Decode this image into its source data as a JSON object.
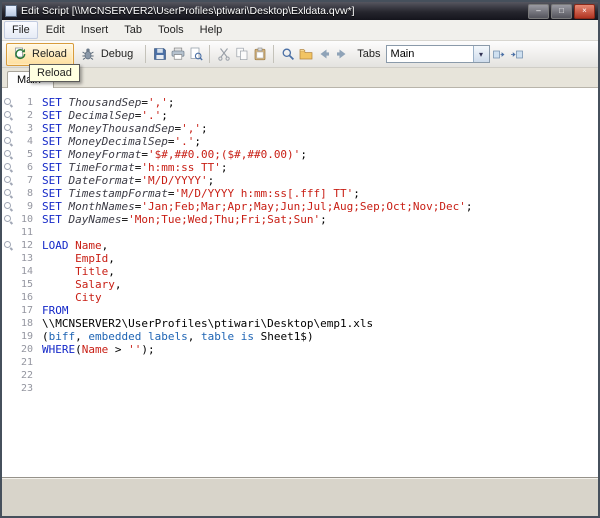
{
  "window": {
    "title": "Edit Script [\\\\MCNSERVER2\\UserProfiles\\ptiwari\\Desktop\\Exldata.qvw*]",
    "buttons": {
      "minimize": "–",
      "maximize": "□",
      "close": "×"
    }
  },
  "menu": {
    "items": [
      "File",
      "Edit",
      "Insert",
      "Tab",
      "Tools",
      "Help"
    ]
  },
  "toolbar": {
    "reload_label": "Reload",
    "debug_label": "Debug",
    "tabs_label": "Tabs",
    "tab_select_value": "Main",
    "dropdown_arrow": "▾",
    "accent_hot_border": "#d89c3c",
    "accent_hot_fill": "#ffdf9c"
  },
  "tabs": {
    "active": "Main"
  },
  "tooltip": {
    "text": "Reload"
  },
  "editor": {
    "syntax_colors": {
      "keyword": "#1428c8",
      "variable": "#3c3c46",
      "string": "#c81e14",
      "field": "#c81e14",
      "format_spec": "#1e64b4",
      "plain": "#000000"
    },
    "lines": [
      {
        "n": "1",
        "m": true,
        "s": [
          [
            "SET ",
            "kw"
          ],
          [
            "ThousandSep",
            "var"
          ],
          [
            "=",
            "pl"
          ],
          [
            "','",
            "str"
          ],
          [
            ";",
            "pl"
          ]
        ]
      },
      {
        "n": "2",
        "m": true,
        "s": [
          [
            "SET ",
            "kw"
          ],
          [
            "DecimalSep",
            "var"
          ],
          [
            "=",
            "pl"
          ],
          [
            "'.'",
            "str"
          ],
          [
            ";",
            "pl"
          ]
        ]
      },
      {
        "n": "3",
        "m": true,
        "s": [
          [
            "SET ",
            "kw"
          ],
          [
            "MoneyThousandSep",
            "var"
          ],
          [
            "=",
            "pl"
          ],
          [
            "','",
            "str"
          ],
          [
            ";",
            "pl"
          ]
        ]
      },
      {
        "n": "4",
        "m": true,
        "s": [
          [
            "SET ",
            "kw"
          ],
          [
            "MoneyDecimalSep",
            "var"
          ],
          [
            "=",
            "pl"
          ],
          [
            "'.'",
            "str"
          ],
          [
            ";",
            "pl"
          ]
        ]
      },
      {
        "n": "5",
        "m": true,
        "s": [
          [
            "SET ",
            "kw"
          ],
          [
            "MoneyFormat",
            "var"
          ],
          [
            "=",
            "pl"
          ],
          [
            "'$#,##0.00;($#,##0.00)'",
            "str"
          ],
          [
            ";",
            "pl"
          ]
        ]
      },
      {
        "n": "6",
        "m": true,
        "s": [
          [
            "SET ",
            "kw"
          ],
          [
            "TimeFormat",
            "var"
          ],
          [
            "=",
            "pl"
          ],
          [
            "'h:mm:ss TT'",
            "str"
          ],
          [
            ";",
            "pl"
          ]
        ]
      },
      {
        "n": "7",
        "m": true,
        "s": [
          [
            "SET ",
            "kw"
          ],
          [
            "DateFormat",
            "var"
          ],
          [
            "=",
            "pl"
          ],
          [
            "'M/D/YYYY'",
            "str"
          ],
          [
            ";",
            "pl"
          ]
        ]
      },
      {
        "n": "8",
        "m": true,
        "s": [
          [
            "SET ",
            "kw"
          ],
          [
            "TimestampFormat",
            "var"
          ],
          [
            "=",
            "pl"
          ],
          [
            "'M/D/YYYY h:mm:ss[.fff] TT'",
            "str"
          ],
          [
            ";",
            "pl"
          ]
        ]
      },
      {
        "n": "9",
        "m": true,
        "s": [
          [
            "SET ",
            "kw"
          ],
          [
            "MonthNames",
            "var"
          ],
          [
            "=",
            "pl"
          ],
          [
            "'Jan;Feb;Mar;Apr;May;Jun;Jul;Aug;Sep;Oct;Nov;Dec'",
            "str"
          ],
          [
            ";",
            "pl"
          ]
        ]
      },
      {
        "n": "10",
        "m": true,
        "s": [
          [
            "SET ",
            "kw"
          ],
          [
            "DayNames",
            "var"
          ],
          [
            "=",
            "pl"
          ],
          [
            "'Mon;Tue;Wed;Thu;Fri;Sat;Sun'",
            "str"
          ],
          [
            ";",
            "pl"
          ]
        ]
      },
      {
        "n": "11",
        "m": false,
        "s": []
      },
      {
        "n": "12",
        "m": true,
        "s": [
          [
            "LOAD ",
            "kw"
          ],
          [
            "Name",
            "fld"
          ],
          [
            ",",
            "pl"
          ]
        ]
      },
      {
        "n": "13",
        "m": false,
        "s": [
          [
            "     ",
            "pl"
          ],
          [
            "EmpId",
            "fld"
          ],
          [
            ",",
            "pl"
          ]
        ]
      },
      {
        "n": "14",
        "m": false,
        "s": [
          [
            "     ",
            "pl"
          ],
          [
            "Title",
            "fld"
          ],
          [
            ",",
            "pl"
          ]
        ]
      },
      {
        "n": "15",
        "m": false,
        "s": [
          [
            "     ",
            "pl"
          ],
          [
            "Salary",
            "fld"
          ],
          [
            ",",
            "pl"
          ]
        ]
      },
      {
        "n": "16",
        "m": false,
        "s": [
          [
            "     ",
            "pl"
          ],
          [
            "City",
            "fld"
          ]
        ]
      },
      {
        "n": "17",
        "m": false,
        "s": [
          [
            "FROM",
            "kw"
          ]
        ]
      },
      {
        "n": "18",
        "m": false,
        "s": [
          [
            "\\\\MCNSERVER2\\UserProfiles\\ptiwari\\Desktop\\emp1.xls",
            "pl"
          ]
        ]
      },
      {
        "n": "19",
        "m": false,
        "s": [
          [
            "(",
            "pl"
          ],
          [
            "biff",
            "fmt"
          ],
          [
            ", ",
            "pl"
          ],
          [
            "embedded labels",
            "fmt"
          ],
          [
            ", ",
            "pl"
          ],
          [
            "table is",
            "fmt"
          ],
          [
            " Sheet1$",
            "pl"
          ],
          [
            ")",
            "pl"
          ]
        ]
      },
      {
        "n": "20",
        "m": false,
        "s": [
          [
            "WHERE",
            "kw"
          ],
          [
            "(",
            "pl"
          ],
          [
            "Name",
            "fld"
          ],
          [
            " > ",
            "pl"
          ],
          [
            "''",
            "str"
          ],
          [
            ");",
            "pl"
          ]
        ]
      },
      {
        "n": "21",
        "m": false,
        "s": []
      },
      {
        "n": "22",
        "m": false,
        "s": []
      },
      {
        "n": "23",
        "m": false,
        "s": []
      }
    ]
  }
}
